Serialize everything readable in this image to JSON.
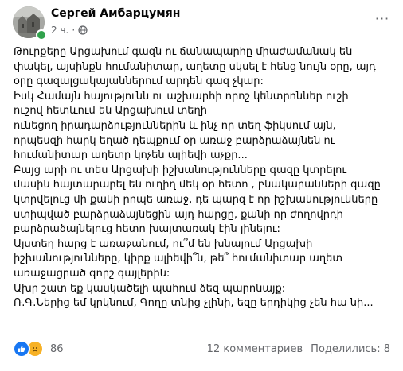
{
  "post": {
    "author": "Сергей Амбарцумян",
    "time": "2 ч.",
    "separator": "·",
    "more_label": "···",
    "body_lines": [
      "Թուրքերը Արցախում  գազն ու ճանապարհը միաժամանակ են",
      "փակել, այսինքն հումանիտար, աղետը սկսել է հենց  նույն օրը, այդ",
      "օրը  գազալցակայաններում արդեն գազ չկար:",
      "Իսկ Համայն հայությունն ու աշխարհի որոշ  կենտրոններ ուշի",
      "ուշով հետևում են Արցախում տեղի",
      "ունեցող իրադարձություններին և ինչ որ տեղ ֆիկսում այն,",
      "որպեսզի հարկ եղած դեպքում օր առաջ բարձրաձայնեն ու",
      "հումանիտար աղետը  կոչեն ալիեվի  աչքը...",
      "Բայց արի ու տես Արցախի իշխանությունները գազը կտրելու",
      "մասին հայտարարել են ուղիղ մեկ  օր հետո , բնակարանների գազը",
      "կտրվելուց մի քանի րոպե առաջ, դե պարզ է որ իշխանությունները",
      "ստիպված բարձրաձայնեցին այդ հարցը, քանի որ   ժողովրդի",
      "բարձրաձայնելուց հետո խայտառակ էին լինելու:",
      "Այստեղ հարց է առաջանում, ու՞մ են խնայում Արցախի",
      "իշխանությունները, կիրք ալիեվի՞ն, թե՞  հումանիտար աղետ",
      "առաջացրած գորշ գայլերին:",
      "Ախր շատ եք կասկածելի պահում ձեզ պարոնայք:",
      "Ռ.Գ.Ներից եմ կրկնում,  Գողը տնից չլինի, եզը երդիկից չեն  հա նի..."
    ],
    "reactions": {
      "count": "86",
      "types": [
        "like-icon",
        "sad-icon"
      ],
      "colors": {
        "like": "#1877f2",
        "sad": "#f7b125"
      }
    },
    "comments_label": "12 комментариев",
    "shares_label": "Поделились: 8"
  }
}
